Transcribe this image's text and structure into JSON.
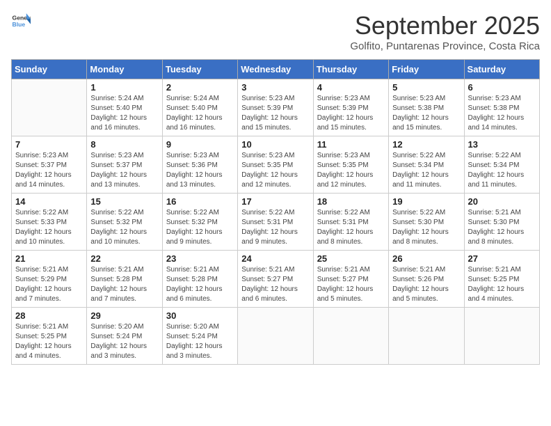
{
  "logo": {
    "text_general": "General",
    "text_blue": "Blue"
  },
  "title": "September 2025",
  "subtitle": "Golfito, Puntarenas Province, Costa Rica",
  "days_of_week": [
    "Sunday",
    "Monday",
    "Tuesday",
    "Wednesday",
    "Thursday",
    "Friday",
    "Saturday"
  ],
  "weeks": [
    [
      {
        "day": "",
        "info": ""
      },
      {
        "day": "1",
        "info": "Sunrise: 5:24 AM\nSunset: 5:40 PM\nDaylight: 12 hours\nand 16 minutes."
      },
      {
        "day": "2",
        "info": "Sunrise: 5:24 AM\nSunset: 5:40 PM\nDaylight: 12 hours\nand 16 minutes."
      },
      {
        "day": "3",
        "info": "Sunrise: 5:23 AM\nSunset: 5:39 PM\nDaylight: 12 hours\nand 15 minutes."
      },
      {
        "day": "4",
        "info": "Sunrise: 5:23 AM\nSunset: 5:39 PM\nDaylight: 12 hours\nand 15 minutes."
      },
      {
        "day": "5",
        "info": "Sunrise: 5:23 AM\nSunset: 5:38 PM\nDaylight: 12 hours\nand 15 minutes."
      },
      {
        "day": "6",
        "info": "Sunrise: 5:23 AM\nSunset: 5:38 PM\nDaylight: 12 hours\nand 14 minutes."
      }
    ],
    [
      {
        "day": "7",
        "info": "Sunrise: 5:23 AM\nSunset: 5:37 PM\nDaylight: 12 hours\nand 14 minutes."
      },
      {
        "day": "8",
        "info": "Sunrise: 5:23 AM\nSunset: 5:37 PM\nDaylight: 12 hours\nand 13 minutes."
      },
      {
        "day": "9",
        "info": "Sunrise: 5:23 AM\nSunset: 5:36 PM\nDaylight: 12 hours\nand 13 minutes."
      },
      {
        "day": "10",
        "info": "Sunrise: 5:23 AM\nSunset: 5:35 PM\nDaylight: 12 hours\nand 12 minutes."
      },
      {
        "day": "11",
        "info": "Sunrise: 5:23 AM\nSunset: 5:35 PM\nDaylight: 12 hours\nand 12 minutes."
      },
      {
        "day": "12",
        "info": "Sunrise: 5:22 AM\nSunset: 5:34 PM\nDaylight: 12 hours\nand 11 minutes."
      },
      {
        "day": "13",
        "info": "Sunrise: 5:22 AM\nSunset: 5:34 PM\nDaylight: 12 hours\nand 11 minutes."
      }
    ],
    [
      {
        "day": "14",
        "info": "Sunrise: 5:22 AM\nSunset: 5:33 PM\nDaylight: 12 hours\nand 10 minutes."
      },
      {
        "day": "15",
        "info": "Sunrise: 5:22 AM\nSunset: 5:32 PM\nDaylight: 12 hours\nand 10 minutes."
      },
      {
        "day": "16",
        "info": "Sunrise: 5:22 AM\nSunset: 5:32 PM\nDaylight: 12 hours\nand 9 minutes."
      },
      {
        "day": "17",
        "info": "Sunrise: 5:22 AM\nSunset: 5:31 PM\nDaylight: 12 hours\nand 9 minutes."
      },
      {
        "day": "18",
        "info": "Sunrise: 5:22 AM\nSunset: 5:31 PM\nDaylight: 12 hours\nand 8 minutes."
      },
      {
        "day": "19",
        "info": "Sunrise: 5:22 AM\nSunset: 5:30 PM\nDaylight: 12 hours\nand 8 minutes."
      },
      {
        "day": "20",
        "info": "Sunrise: 5:21 AM\nSunset: 5:30 PM\nDaylight: 12 hours\nand 8 minutes."
      }
    ],
    [
      {
        "day": "21",
        "info": "Sunrise: 5:21 AM\nSunset: 5:29 PM\nDaylight: 12 hours\nand 7 minutes."
      },
      {
        "day": "22",
        "info": "Sunrise: 5:21 AM\nSunset: 5:28 PM\nDaylight: 12 hours\nand 7 minutes."
      },
      {
        "day": "23",
        "info": "Sunrise: 5:21 AM\nSunset: 5:28 PM\nDaylight: 12 hours\nand 6 minutes."
      },
      {
        "day": "24",
        "info": "Sunrise: 5:21 AM\nSunset: 5:27 PM\nDaylight: 12 hours\nand 6 minutes."
      },
      {
        "day": "25",
        "info": "Sunrise: 5:21 AM\nSunset: 5:27 PM\nDaylight: 12 hours\nand 5 minutes."
      },
      {
        "day": "26",
        "info": "Sunrise: 5:21 AM\nSunset: 5:26 PM\nDaylight: 12 hours\nand 5 minutes."
      },
      {
        "day": "27",
        "info": "Sunrise: 5:21 AM\nSunset: 5:25 PM\nDaylight: 12 hours\nand 4 minutes."
      }
    ],
    [
      {
        "day": "28",
        "info": "Sunrise: 5:21 AM\nSunset: 5:25 PM\nDaylight: 12 hours\nand 4 minutes."
      },
      {
        "day": "29",
        "info": "Sunrise: 5:20 AM\nSunset: 5:24 PM\nDaylight: 12 hours\nand 3 minutes."
      },
      {
        "day": "30",
        "info": "Sunrise: 5:20 AM\nSunset: 5:24 PM\nDaylight: 12 hours\nand 3 minutes."
      },
      {
        "day": "",
        "info": ""
      },
      {
        "day": "",
        "info": ""
      },
      {
        "day": "",
        "info": ""
      },
      {
        "day": "",
        "info": ""
      }
    ]
  ]
}
